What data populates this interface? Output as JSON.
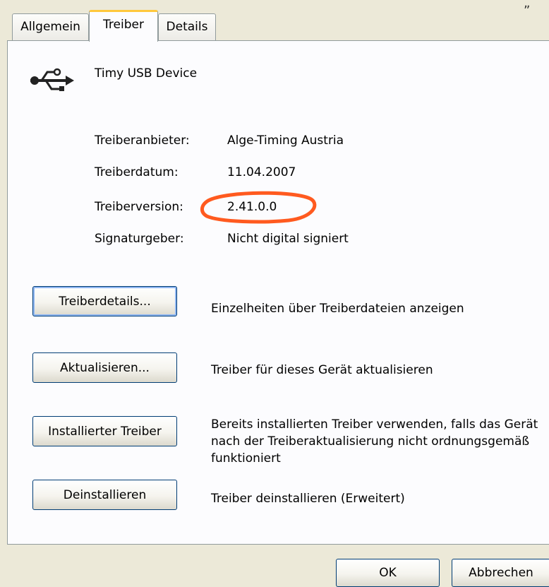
{
  "corner_mark": "„",
  "tabs": [
    {
      "label": "Allgemein"
    },
    {
      "label": "Treiber"
    },
    {
      "label": "Details"
    }
  ],
  "device": {
    "name": "Timy USB Device",
    "icon": "usb-icon"
  },
  "properties": [
    {
      "label": "Treiberanbieter:",
      "value": "Alge-Timing Austria"
    },
    {
      "label": "Treiberdatum:",
      "value": "11.04.2007"
    },
    {
      "label": "Treiberversion:",
      "value": "2.41.0.0"
    },
    {
      "label": "Signaturgeber:",
      "value": "Nicht digital signiert"
    }
  ],
  "actions": [
    {
      "button": "Treiberdetails...",
      "description": "Einzelheiten über Treiberdateien anzeigen"
    },
    {
      "button": "Aktualisieren...",
      "description": "Treiber für dieses Gerät aktualisieren"
    },
    {
      "button": "Installierter Treiber",
      "description": "Bereits installierten Treiber verwenden, falls das Gerät nach der Treiberaktualisierung nicht ordnungsgemäß funktioniert"
    },
    {
      "button": "Deinstallieren",
      "description": "Treiber deinstallieren (Erweitert)"
    }
  ],
  "dialog_buttons": {
    "ok": "OK",
    "cancel": "Abbrechen"
  },
  "colors": {
    "highlight": "#ff5a1f",
    "dialog_bg": "#ece9d8",
    "tab_accent": "#ffc83c",
    "button_border": "#003c74"
  }
}
